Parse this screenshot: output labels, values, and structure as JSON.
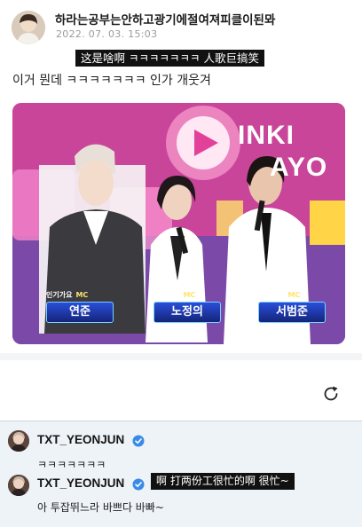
{
  "post": {
    "author": "하라는공부는안하고광기에절여져피클이된뫄",
    "date": "2022. 07. 03. 15:03",
    "subtitle_cn": "这是啥啊 ㅋㅋㅋㅋㅋㅋㅋ 人歌巨搞笑",
    "text": "이거 뭔데 ㅋㅋㅋㅋㅋㅋㅋ 인가 개웃겨"
  },
  "image": {
    "logo_line1": "INKI",
    "logo_line2": "AYO",
    "badges": [
      {
        "program": "인기가요",
        "role": "MC",
        "name": "연준"
      },
      {
        "program": "인기가요",
        "role": "MC",
        "name": "노정의"
      },
      {
        "program": "인기가요",
        "role": "MC",
        "name": "서범준"
      }
    ]
  },
  "refresh": {
    "icon": "refresh-icon"
  },
  "comments": [
    {
      "user": "TXT_YEONJUN",
      "verified": true,
      "text": "ㅋㅋㅋㅋㅋㅋㅋ",
      "subtitle": ""
    },
    {
      "user": "TXT_YEONJUN",
      "verified": true,
      "text": "아 투잡뛰느라 바쁘다 바빠~",
      "subtitle": "啊 打两份工很忙的啊 很忙~"
    }
  ],
  "colors": {
    "verified": "#3a8be8",
    "panel_bg": "#eef3f8",
    "mc_badge": "#1f3cb8"
  }
}
